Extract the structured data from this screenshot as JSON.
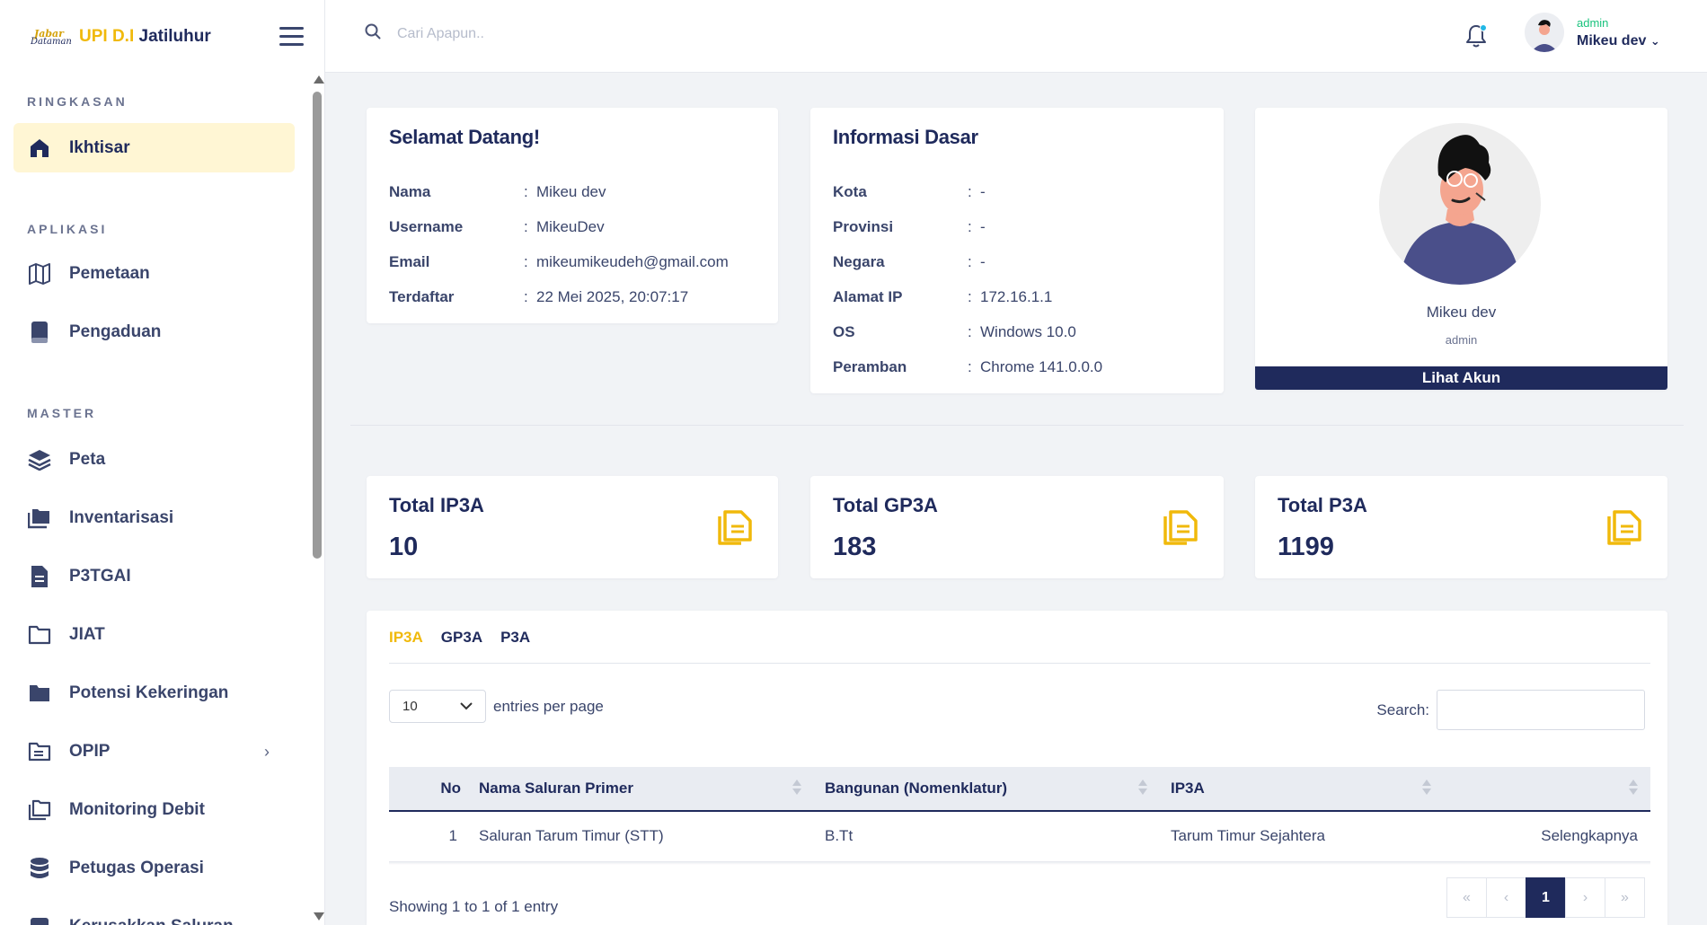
{
  "brand": {
    "logo_line1": "Jabar",
    "logo_line2": "Dataman",
    "title_yellow": "UPI D.I",
    "title_dark": " Jatiluhur"
  },
  "sidebar": {
    "sections": [
      "RINGKASAN",
      "APLIKASI",
      "MASTER"
    ],
    "items": [
      {
        "label": "Ikhtisar",
        "icon": "home-icon",
        "active": true
      },
      {
        "label": "Pemetaan",
        "icon": "map-icon"
      },
      {
        "label": "Pengaduan",
        "icon": "book-icon"
      },
      {
        "label": "Peta",
        "icon": "layers-icon"
      },
      {
        "label": "Inventarisasi",
        "icon": "folders-icon"
      },
      {
        "label": "P3TGAI",
        "icon": "document-icon"
      },
      {
        "label": "JIAT",
        "icon": "folder-outline-icon"
      },
      {
        "label": "Potensi Kekeringan",
        "icon": "folder-icon"
      },
      {
        "label": "OPIP",
        "icon": "folder-list-icon"
      },
      {
        "label": "Monitoring Debit",
        "icon": "copy-icon"
      },
      {
        "label": "Petugas Operasi",
        "icon": "database-icon"
      },
      {
        "label": "Kerusakkan Saluran",
        "icon": "list-icon"
      }
    ]
  },
  "topbar": {
    "search_placeholder": "Cari Apapun..",
    "user_role": "admin",
    "user_name": "Mikeu dev"
  },
  "welcome": {
    "title": "Selamat Datang!",
    "rows": [
      {
        "key": "Nama",
        "sep": ":",
        "value": "Mikeu dev"
      },
      {
        "key": "Username",
        "sep": ":",
        "value": "MikeuDev"
      },
      {
        "key": "Email",
        "sep": ":",
        "value": "mikeumikeudeh@gmail.com"
      },
      {
        "key": "Terdaftar",
        "sep": ":",
        "value": "22 Mei 2025, 20:07:17"
      }
    ]
  },
  "info": {
    "title": "Informasi Dasar",
    "rows": [
      {
        "key": "Kota",
        "sep": ":",
        "value": "-"
      },
      {
        "key": "Provinsi",
        "sep": ":",
        "value": "-"
      },
      {
        "key": "Negara",
        "sep": ":",
        "value": "-"
      },
      {
        "key": "Alamat IP",
        "sep": ":",
        "value": "172.16.1.1"
      },
      {
        "key": "OS",
        "sep": ":",
        "value": "Windows 10.0"
      },
      {
        "key": "Peramban",
        "sep": ":",
        "value": "Chrome 141.0.0.0"
      }
    ]
  },
  "profile": {
    "name": "Mikeu dev",
    "role": "admin",
    "button": "Lihat Akun"
  },
  "stats": [
    {
      "title": "Total IP3A",
      "value": "10"
    },
    {
      "title": "Total GP3A",
      "value": "183"
    },
    {
      "title": "Total P3A",
      "value": "1199"
    }
  ],
  "table_card": {
    "tabs": [
      "IP3A",
      "GP3A",
      "P3A"
    ],
    "entries_value": "10",
    "entries_label": "entries per page",
    "search_label": "Search:",
    "columns": [
      "No",
      "Nama Saluran Primer",
      "Bangunan (Nomenklatur)",
      "IP3A",
      ""
    ],
    "rows": [
      [
        "1",
        "Saluran Tarum Timur (STT)",
        "B.Tt",
        "Tarum Timur Sejahtera",
        "Selengkapnya"
      ]
    ],
    "showing": "Showing 1 to 1 of 1 entry",
    "pager": [
      "«",
      "‹",
      "1",
      "›",
      "»"
    ]
  },
  "colors": {
    "primary": "#1f2a5c",
    "accent": "#f0b90b",
    "role_green": "#19c37d"
  }
}
